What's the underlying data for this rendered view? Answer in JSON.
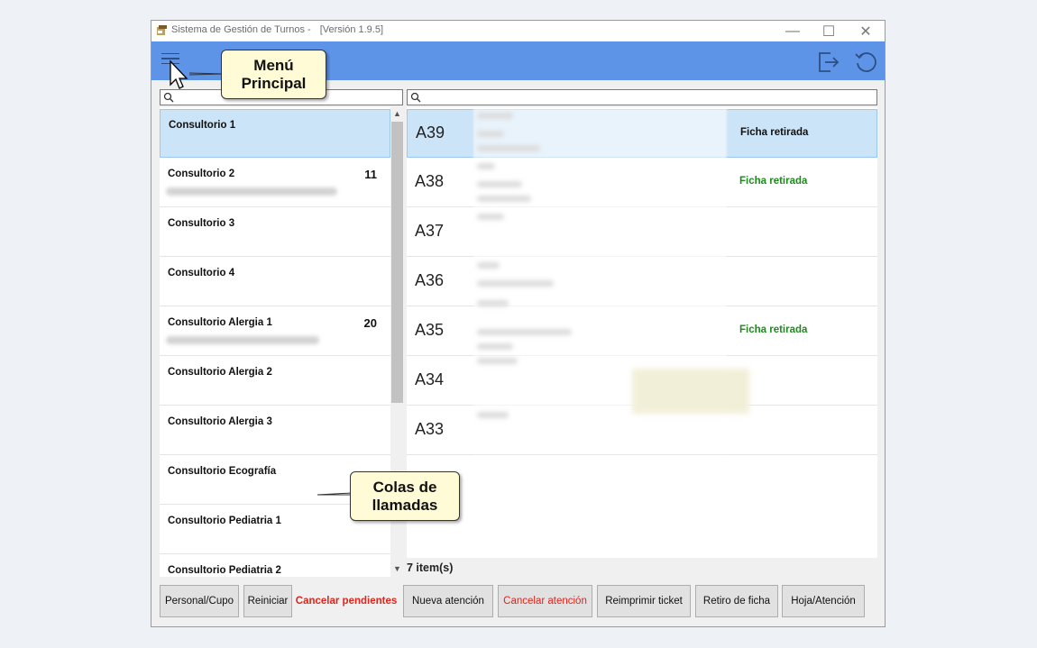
{
  "window": {
    "title": "Sistema de Gestión de Turnos  -",
    "version": "[Versión 1.9.5]",
    "controls": {
      "minimize": "—",
      "maximize": "☐",
      "close": "✕"
    }
  },
  "toolbar": {
    "menu_icon": "hamburger-menu-icon",
    "exit_icon": "exit-icon",
    "refresh_icon": "refresh-icon"
  },
  "left_search": {
    "icon": "search-icon",
    "value": ""
  },
  "right_search": {
    "icon": "search-icon",
    "value": ""
  },
  "queues": [
    {
      "name": "Consultorio 1",
      "count": "",
      "selected": true
    },
    {
      "name": "Consultorio 2",
      "count": "11"
    },
    {
      "name": "Consultorio 3",
      "count": ""
    },
    {
      "name": "Consultorio 4",
      "count": ""
    },
    {
      "name": "Consultorio Alergia 1",
      "count": "20"
    },
    {
      "name": "Consultorio Alergia 2",
      "count": ""
    },
    {
      "name": "Consultorio Alergia 3",
      "count": ""
    },
    {
      "name": "Consultorio Ecografía",
      "count": ""
    },
    {
      "name": "Consultorio Pediatria 1",
      "count": ""
    },
    {
      "name": "Consultorio Pediatria 2",
      "count": ""
    }
  ],
  "tickets": [
    {
      "code": "A39",
      "status": "Ficha retirada",
      "status_color": "#111111",
      "selected": true
    },
    {
      "code": "A38",
      "status": "Ficha retirada",
      "status_color": "#1e8a1e"
    },
    {
      "code": "A37",
      "status": ""
    },
    {
      "code": "A36",
      "status": ""
    },
    {
      "code": "A35",
      "status": "Ficha retirada",
      "status_color": "#1e8a1e"
    },
    {
      "code": "A34",
      "status": ""
    },
    {
      "code": "A33",
      "status": ""
    }
  ],
  "items_count": "7 item(s)",
  "buttons": {
    "personal_cupo": "Personal/Cupo",
    "reiniciar": "Reiniciar",
    "cancelar_pendientes": "Cancelar pendientes",
    "nueva_atencion": "Nueva atención",
    "cancelar_atencion": "Cancelar atención",
    "reimprimir_ticket": "Reimprimir ticket",
    "retiro_ficha": "Retiro de ficha",
    "hoja_atencion": "Hoja/Atención"
  },
  "callouts": {
    "menu_line1": "Menú",
    "menu_line2": "Principal",
    "colas_line1": "Colas de",
    "colas_line2": "llamadas"
  },
  "colors": {
    "toolbar": "#5e94e8",
    "selection": "#cce4f7",
    "danger": "#e0241c",
    "success": "#1e8a1e",
    "callout": "#fffbd6"
  }
}
